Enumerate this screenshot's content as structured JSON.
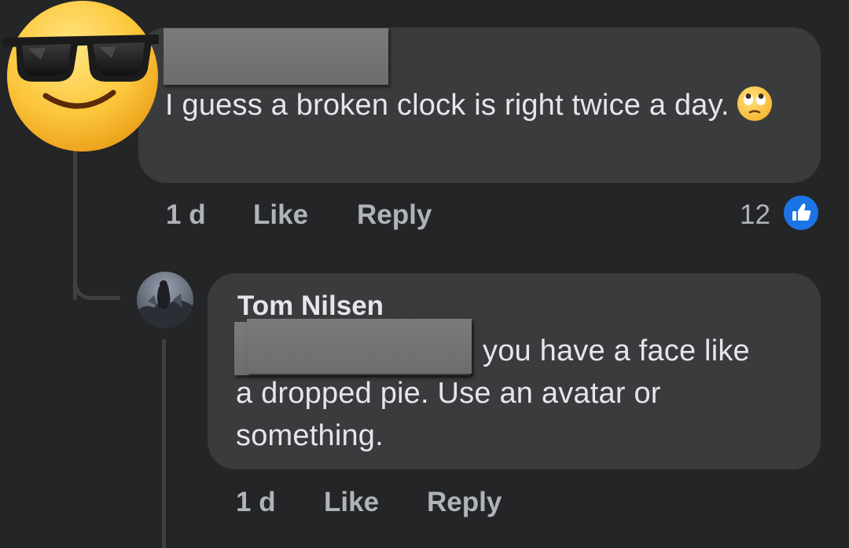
{
  "comment_1": {
    "text": "I guess a broken clock is right twice a day.",
    "emoji": "eye-roll-emoji",
    "timestamp": "1 d",
    "like_label": "Like",
    "reply_label": "Reply",
    "reaction_count": "12",
    "reaction_icon": "thumbs-up-icon",
    "author_avatar": "sunglasses-emoji-avatar"
  },
  "comment_2": {
    "author": "Tom Nilsen",
    "text_line_1": "you have a face like",
    "text_line_2": "a dropped pie. Use an avatar or",
    "text_line_3": "something.",
    "timestamp": "1 d",
    "like_label": "Like",
    "reply_label": "Reply",
    "author_avatar": "profile-photo-avatar"
  },
  "colors": {
    "background": "#242526",
    "bubble": "#3a3b3c",
    "text": "#e4e6eb",
    "meta": "#b0b3b8",
    "like_badge": "#1b74e4",
    "thread_line": "#3e4042"
  }
}
